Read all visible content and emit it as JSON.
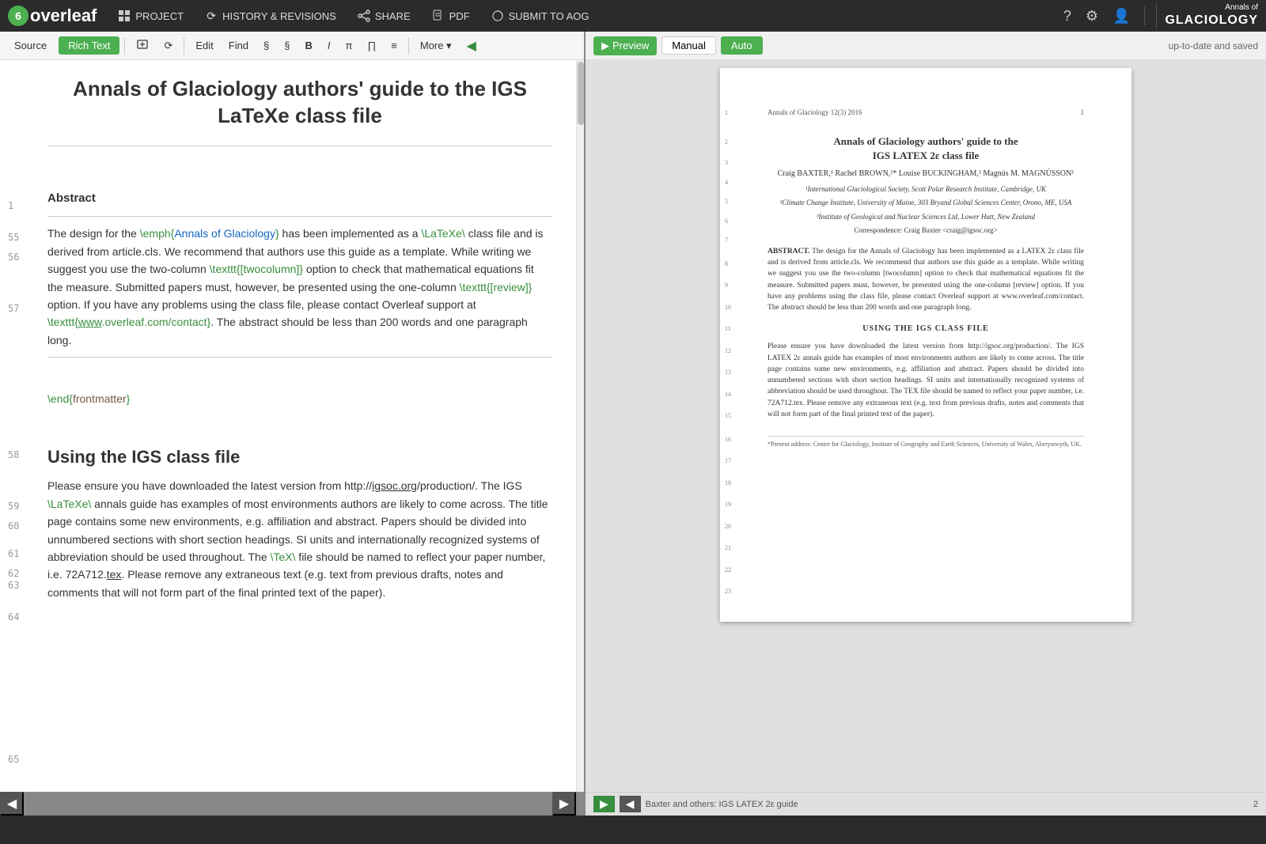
{
  "logo": {
    "six": "6",
    "name": "overleaf"
  },
  "topbar": {
    "project_icon": "☰",
    "project_label": "PROJECT",
    "history_icon": "⟳",
    "history_label": "HISTORY & REVISIONS",
    "share_icon": "⬡",
    "share_label": "SHARE",
    "pdf_icon": "📄",
    "pdf_label": "PDF",
    "submit_icon": "🌐",
    "submit_label": "SUBMIT TO AOG",
    "help_icon": "?",
    "settings_icon": "⚙",
    "user_icon": "👤"
  },
  "journal": {
    "annals": "Annals of",
    "name": "GLACIOLOGY"
  },
  "toolbar": {
    "source_label": "Source",
    "richtext_label": "Rich Text",
    "insert_icon": "↵",
    "history_icon": "⟳",
    "edit_label": "Edit",
    "find_label": "Find",
    "section_icon": "§",
    "subsection_icon": "§",
    "bold_label": "B",
    "italic_label": "I",
    "pi_label": "π",
    "matrix_label": "∏",
    "list_label": "≡",
    "more_label": "More ▾",
    "collapse_icon": "▶"
  },
  "preview_toolbar": {
    "preview_label": "Preview",
    "manual_label": "Manual",
    "auto_label": "Auto",
    "status": "up-to-date and saved"
  },
  "editor": {
    "title": "Annals of Glaciology authors' guide to the IGS LaTeXe class file",
    "line_numbers": [
      "1",
      "55",
      "56",
      "57",
      "58",
      "59",
      "60",
      "61",
      "62",
      "63",
      "64",
      "65"
    ],
    "abstract_heading": "Abstract",
    "abstract_text": "The design for the \\emph{Annals of Glaciology} has been implemented as a \\LaTeXe\\ class file and is derived from article.cls. We recommend that authors use this guide as a template. While writing we suggest you use the two-column \\texttt{[twocolumn]} option to check that mathematical equations fit the measure. Submitted papers must, however, be presented using the one-column \\texttt{[review]} option. If you have any problems using the class file, please contact Overleaf support at \\texttt{www.overleaf.com/contact}. The abstract should be less than 200 words and one paragraph long.",
    "end_frontmatter": "\\end{frontmatter}",
    "section2_heading": "Using the IGS class file",
    "section2_text": "Please ensure you have downloaded the latest version from http://igsoc.org/production/. The IGS \\LaTeXe\\ annals guide has examples of most environments authors are likely to come across. The title page contains some new environments, e.g. affiliation and abstract. Papers should be divided into unnumbered sections with short section headings. SI units and internationally recognized systems of abbreviation should be used throughout. The \\TeX\\ file should be named to reflect your paper number, i.e. 72A712.tex. Please remove any extraneous text (e.g. text from previous drafts, notes and comments that will not form part of the final printed text of the paper)."
  },
  "preview": {
    "page1": {
      "header_left": "Annals of Glaciology 12(3) 2016",
      "header_right": "1",
      "title_line1": "Annals of Glaciology authors' guide to the",
      "title_line2": "IGS LATEX 2ε class file",
      "authors": "Craig BAXTER,¹ Rachel BROWN,²* Louise BUCKINGHAM,³ Magnús M. MAGNÚSSON¹",
      "affil1": "¹International Glaciological Society, Scott Polar Research Institute, Cambridge, UK",
      "affil2": "²Climate Change Institute, University of Maine, 303 Bryand Global Sciences Center, Orono, ME, USA",
      "affil3": "³Institute of Geological and Nuclear Sciences Ltd, Lower Hutt, New Zealand",
      "correspondence": "Correspondence: Craig Baxter <craig@igsoc.org>",
      "abstract_label": "ABSTRACT.",
      "abstract_text": "The design for the Annals of Glaciology has been implemented as a LATEX 2ε class file and is derived from article.cls. We recommend that authors use this guide as a template. While writing we suggest you use the two-column [twocolumn] option to check that mathematical equations fit the measure. Submitted papers must, however, be presented using the one-column [review] option. If you have any problems using the class file, please contact Overleaf support at www.overleaf.com/contact. The abstract should be less than 200 words and one paragraph long.",
      "section_heading": "USING THE IGS CLASS FILE",
      "body_text": "Please ensure you have downloaded the latest version from http://igsoc.org/production/. The IGS LATEX 2ε annals guide has examples of most environments authors are likely to come across. The title page contains some new environments, e.g. affiliation and abstract. Papers should be divided into unnumbered sections with short section headings. SI units and internationally recognized systems of abbreviation should be used throughout. The TEX file should be named to reflect your paper number, i.e. 72A712.tex. Please remove any extraneous text (e.g. text from previous drafts, notes and comments that will not form part of the final printed text of the paper).",
      "footnote": "*Present address: Centre for Glaciology, Institute of Geography and Earth Sciences, University of Wales, Aberystwyth, UK."
    },
    "page2": {
      "footer_left": "Baxter and others: IGS LATEX 2ε guide",
      "footer_right": "2"
    },
    "line_nums": [
      "1",
      "2",
      "3",
      "4",
      "5",
      "6",
      "7",
      "8",
      "9",
      "10",
      "11",
      "12",
      "13",
      "14",
      "15",
      "16",
      "17",
      "18",
      "19",
      "20",
      "21",
      "22",
      "23"
    ]
  }
}
